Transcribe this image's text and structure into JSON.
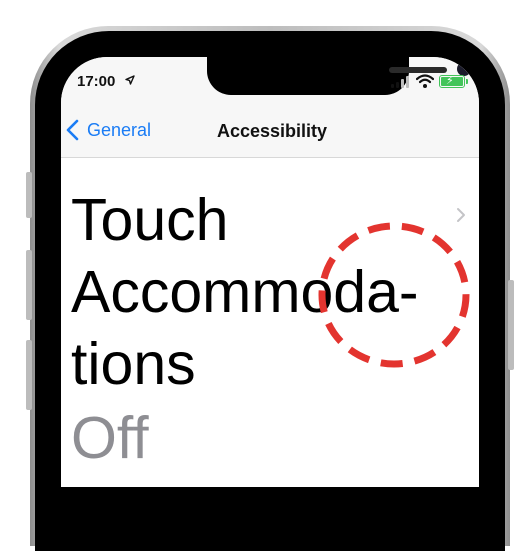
{
  "status_bar": {
    "time": "17:00",
    "location_icon": "location-arrow-icon",
    "signal_icon": "cellular-signal-icon",
    "wifi_icon": "wifi-icon",
    "battery_icon": "battery-charging-icon",
    "battery_color": "#43c45a"
  },
  "nav_bar": {
    "back_label": "General",
    "title": "Accessibility",
    "accent_color": "#1a7cf5"
  },
  "setting_row": {
    "title_lines": [
      "Touch",
      "Accommoda-",
      "tions"
    ],
    "value": "Off",
    "value_color": "#8e8e93"
  },
  "annotation": {
    "type": "dashed-circle",
    "color": "#e3342f"
  }
}
